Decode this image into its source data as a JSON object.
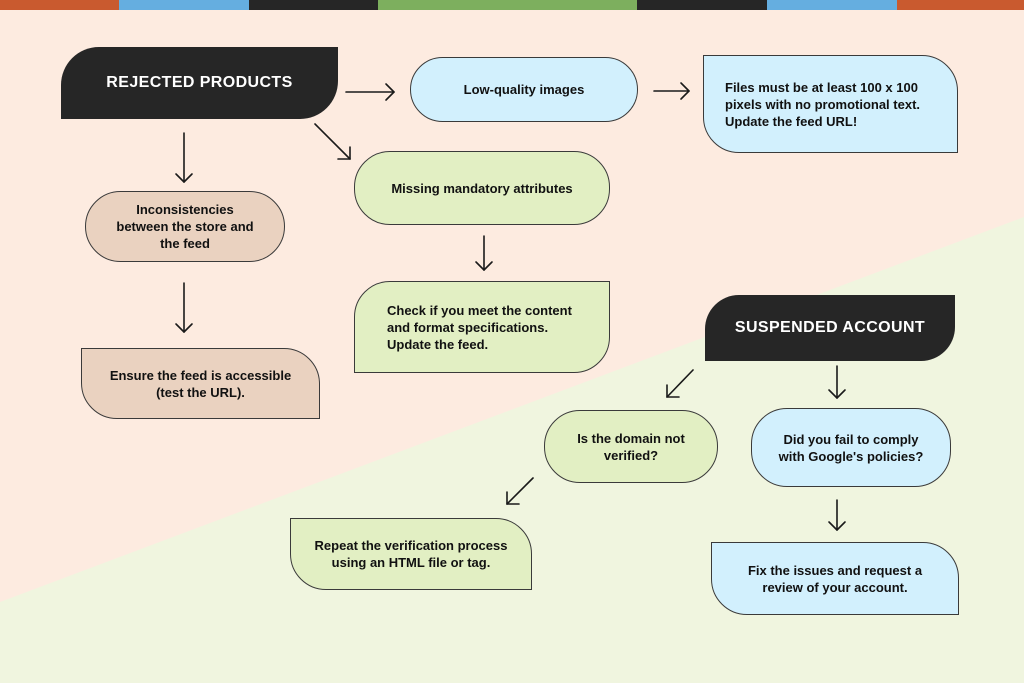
{
  "colors": {
    "bg_top": "#fdebe0",
    "bg_bottom": "#f0f5df",
    "dark": "#262626",
    "blue": "#d2f0fd",
    "green": "#e2efc3",
    "tan": "#ead2c0",
    "stripe_orange": "#c95a2f",
    "stripe_blue": "#65aee0",
    "stripe_dark": "#262626",
    "stripe_green": "#7daf5e"
  },
  "stripe": [
    "orange",
    "blue",
    "dark",
    "green",
    "dark",
    "blue",
    "orange"
  ],
  "rejected": {
    "title": "REJECTED PRODUCTS",
    "low_quality": "Low-quality images",
    "low_quality_fix": [
      "Files must be at least 100 x 100",
      "pixels with no promotional text.",
      "Update the feed URL!"
    ],
    "inconsistencies": [
      "Inconsistencies",
      "between the store and",
      "the feed"
    ],
    "inconsistencies_fix": [
      "Ensure the feed is accessible",
      "(test the URL)."
    ],
    "missing": "Missing mandatory attributes",
    "missing_fix": [
      "Check if you meet the content",
      "and format specifications.",
      "Update the feed."
    ]
  },
  "suspended": {
    "title": "SUSPENDED ACCOUNT",
    "domain": [
      "Is the domain not",
      "verified?"
    ],
    "domain_fix": [
      "Repeat the verification process",
      "using an HTML file or tag."
    ],
    "policies": [
      "Did you fail to comply",
      "with Google's policies?"
    ],
    "policies_fix": [
      "Fix the issues and request a",
      "review of your account."
    ]
  }
}
